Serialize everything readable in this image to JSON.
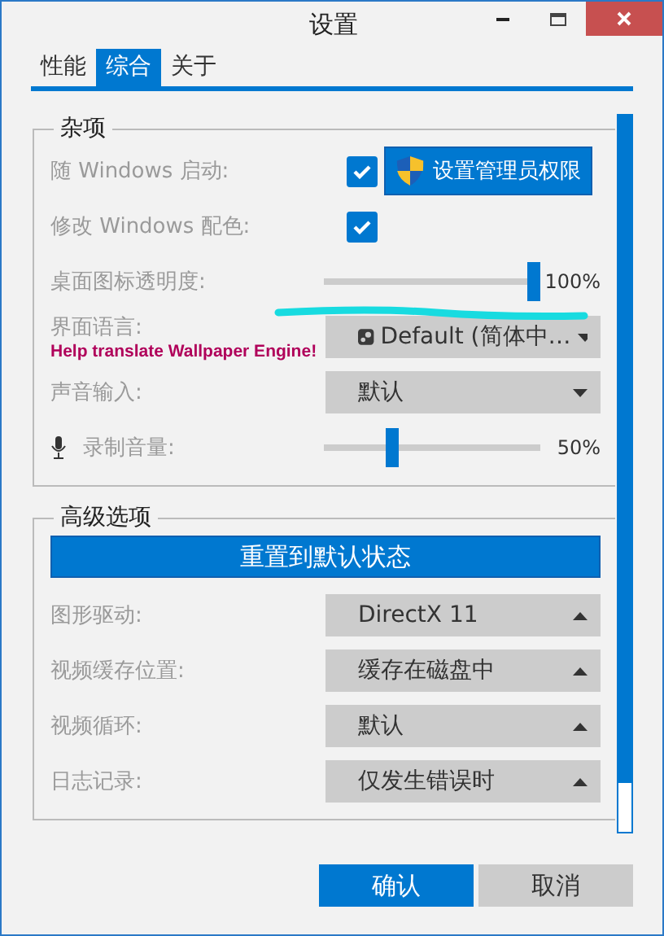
{
  "window": {
    "title": "设置"
  },
  "tabs": [
    {
      "label": "性能",
      "selected": false
    },
    {
      "label": "综合",
      "selected": true
    },
    {
      "label": "关于",
      "selected": false
    }
  ],
  "groups": [
    {
      "title": "杂项",
      "rows": [
        {
          "kind": "checkbox",
          "label": "随 Windows 启动:",
          "checked": true,
          "button": "设置管理员权限"
        },
        {
          "kind": "checkbox",
          "label": "修改 Windows 配色:",
          "checked": true
        },
        {
          "kind": "slider",
          "label": "桌面图标透明度:",
          "level": 1,
          "reading": "100%",
          "highlighted": true
        },
        {
          "kind": "language",
          "label": "界面语言:",
          "value": "Default (简体中…",
          "link": "Help translate Wallpaper Engine!"
        },
        {
          "kind": "dropdown",
          "label": "声音输入:",
          "value": "默认"
        },
        {
          "kind": "volume",
          "label": "录制音量:",
          "level": 0.3,
          "reading": "50%"
        }
      ]
    },
    {
      "title": "高级选项",
      "button": "重置到默认状态",
      "rows": [
        {
          "kind": "dropup",
          "label": "图形驱动:",
          "value": "DirectX 11"
        },
        {
          "kind": "dropup",
          "label": "视频缓存位置:",
          "value": "缓存在磁盘中"
        },
        {
          "kind": "dropup",
          "label": "视频循环:",
          "value": "默认"
        },
        {
          "kind": "dropup",
          "label": "日志记录:",
          "value": "仅发生错误时"
        }
      ]
    }
  ],
  "buttons": [
    {
      "label": "确认",
      "primary": true
    },
    {
      "label": "取消",
      "primary": false
    }
  ]
}
